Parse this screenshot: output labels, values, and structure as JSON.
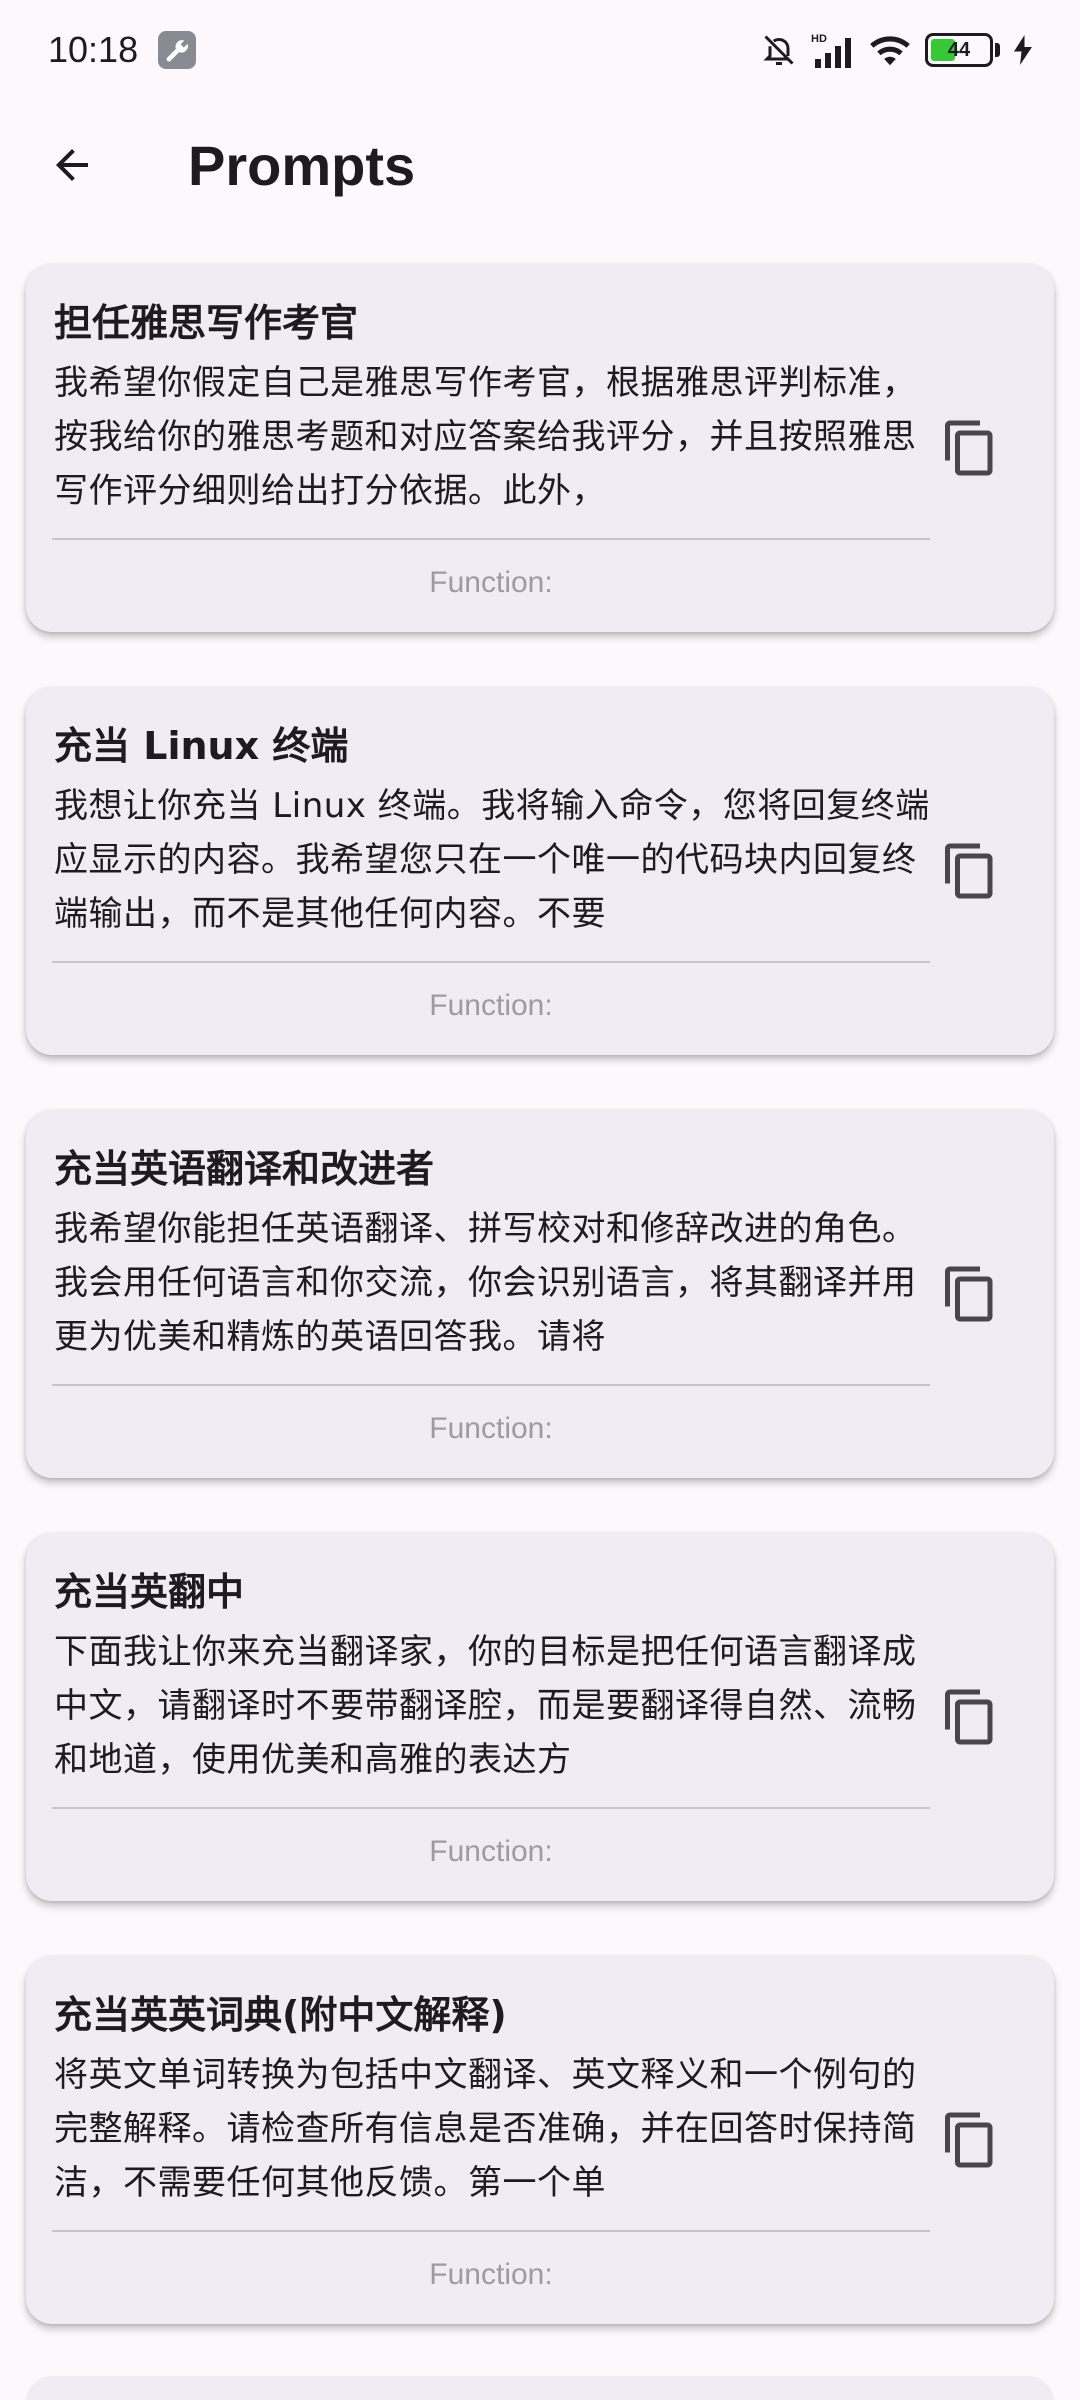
{
  "status_bar": {
    "time": "10:18",
    "battery_level": "44",
    "signal_label": "HD"
  },
  "app_bar": {
    "title": "Prompts"
  },
  "prompts": [
    {
      "title": "担任雅思写作考官",
      "body": "我希望你假定自己是雅思写作考官，根据雅思评判标准，按我给你的雅思考题和对应答案给我评分，并且按照雅思写作评分细则给出打分依据。此外，",
      "function": "Function:"
    },
    {
      "title": "充当 Linux 终端",
      "body": "我想让你充当 Linux 终端。我将输入命令，您将回复终端应显示的内容。我希望您只在一个唯一的代码块内回复终端输出，而不是其他任何内容。不要",
      "function": "Function:"
    },
    {
      "title": "充当英语翻译和改进者",
      "body": "我希望你能担任英语翻译、拼写校对和修辞改进的角色。我会用任何语言和你交流，你会识别语言，将其翻译并用更为优美和精炼的英语回答我。请将",
      "function": "Function:"
    },
    {
      "title": "充当英翻中",
      "body": "下面我让你来充当翻译家，你的目标是把任何语言翻译成中文，请翻译时不要带翻译腔，而是要翻译得自然、流畅和地道，使用优美和高雅的表达方",
      "function": "Function:"
    },
    {
      "title": "充当英英词典(附中文解释)",
      "body": "将英文单词转换为包括中文翻译、英文释义和一个例句的完整解释。请检查所有信息是否准确，并在回答时保持简洁，不需要任何其他反馈。第一个单",
      "function": "Function:"
    }
  ]
}
